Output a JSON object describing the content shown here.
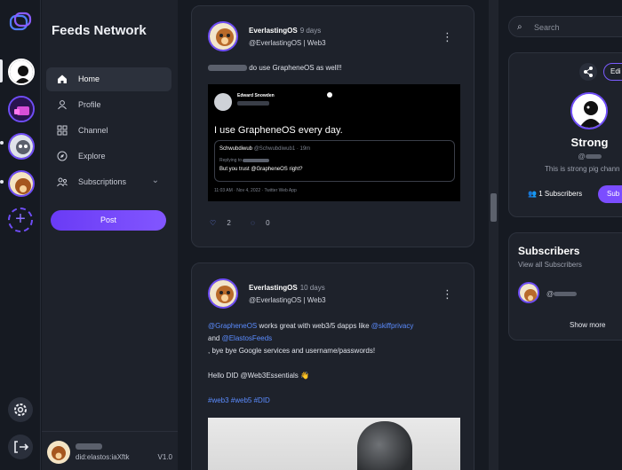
{
  "app": {
    "brand": "Feeds Network",
    "version": "V1.0"
  },
  "nav": {
    "items": [
      {
        "label": "Home",
        "icon": "home-icon",
        "active": true
      },
      {
        "label": "Profile",
        "icon": "profile-icon"
      },
      {
        "label": "Channel",
        "icon": "channel-icon"
      },
      {
        "label": "Explore",
        "icon": "compass-icon"
      },
      {
        "label": "Subscriptions",
        "icon": "subscriptions-icon"
      }
    ],
    "post_label": "Post",
    "user": {
      "did": "did:elastos:iaXftk"
    }
  },
  "feed": {
    "posts": [
      {
        "name": "EverlastingOS",
        "age": "9 days",
        "handle": "@EverlastingOS | Web3",
        "text": "do use GrapheneOS as well!!",
        "embed": {
          "author": "Edward Snowden",
          "text": "I use GrapheneOS every day.",
          "quote_author": "Schwubdiwub",
          "quote_handle": "@Schwubdiwub1 · 19m",
          "replying": "Replying to",
          "quote_text": "But you trust @GrapheneOS right?",
          "meta": "11:03 AM · Nov 4, 2022 · Twitter Web App"
        },
        "likes": "2",
        "comments": "0"
      },
      {
        "name": "EverlastingOS",
        "age": "10 days",
        "handle": "@EverlastingOS | Web3",
        "mention1": "@GrapheneOS",
        "text1": " works great with web3/5 dapps like ",
        "mention2": "@skiffprivacy",
        "text2": "and ",
        "mention3": "@ElastosFeeds",
        "text3": ", bye bye Google services and username/passwords!",
        "text4": "Hello DID @Web3Essentials 👋",
        "tags": "#web3 #web5 #DID"
      }
    ]
  },
  "right": {
    "search_placeholder": "Search",
    "channel": {
      "name": "Strong",
      "handle_prefix": "@",
      "description": "This is strong pig chann",
      "subscribers": "1 Subscribers",
      "edit_label": "Edi",
      "subscribe_label": "Sub"
    },
    "subscribers": {
      "title": "Subscribers",
      "view_all": "View all Subscribers",
      "handle_prefix": "@",
      "show_more": "Show more"
    }
  },
  "colors": {
    "accent": "#6f4df7",
    "link": "#5b8cff",
    "bg": "#161a22",
    "panel": "#1e222b"
  }
}
